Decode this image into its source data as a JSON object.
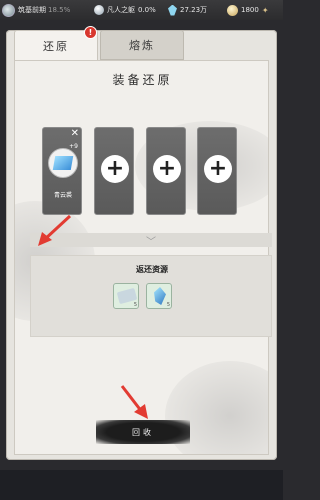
{
  "status_bar": {
    "realm": "筑基前期",
    "realm_progress": "18.5%",
    "stage": "凡人之躯",
    "stage_progress": "0.0%",
    "crystals": "27.23万",
    "coins": "1800"
  },
  "tabs": [
    {
      "label": "还原",
      "badge": "!"
    },
    {
      "label": "熔炼"
    }
  ],
  "section_title": "装备还原",
  "slots": {
    "filled": {
      "item_name": "青云裘",
      "level": "+9"
    },
    "empty_symbol": "+"
  },
  "return_resources": {
    "title": "返还资源",
    "items": [
      {
        "icon": "scroll-icon",
        "qty": "5"
      },
      {
        "icon": "crystal-icon",
        "qty": "5"
      }
    ]
  },
  "recycle_button": "回收",
  "colors": {
    "annotation_arrow": "#e23b32",
    "badge": "#d8372e",
    "slot_bg": "#6a6a6a"
  }
}
